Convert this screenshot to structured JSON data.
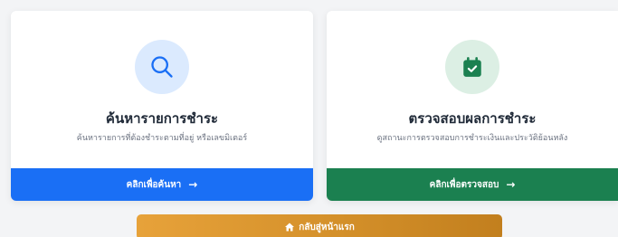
{
  "search_card": {
    "icon": "search-icon",
    "title": "ค้นหารายการชำระ",
    "subtitle": "ค้นหารายการที่ต้องชำระตามที่อยู่ หรือเลขมิเตอร์",
    "button_label": "คลิกเพื่อค้นหา",
    "button_arrow": "→",
    "accent_color": "#1a6ff5"
  },
  "check_card": {
    "icon": "calendar-check-icon",
    "title": "ตรวจสอบผลการชำระ",
    "subtitle": "ดูสถานะการตรวจสอบการชำระเงินและประวัติย้อนหลัง",
    "button_label": "คลิกเพื่อตรวจสอบ",
    "button_arrow": "→",
    "accent_color": "#1b8050"
  },
  "home_button": {
    "icon": "home-icon",
    "label": "กลับสู่หน้าแรก",
    "accent_color": "#d4902a"
  }
}
